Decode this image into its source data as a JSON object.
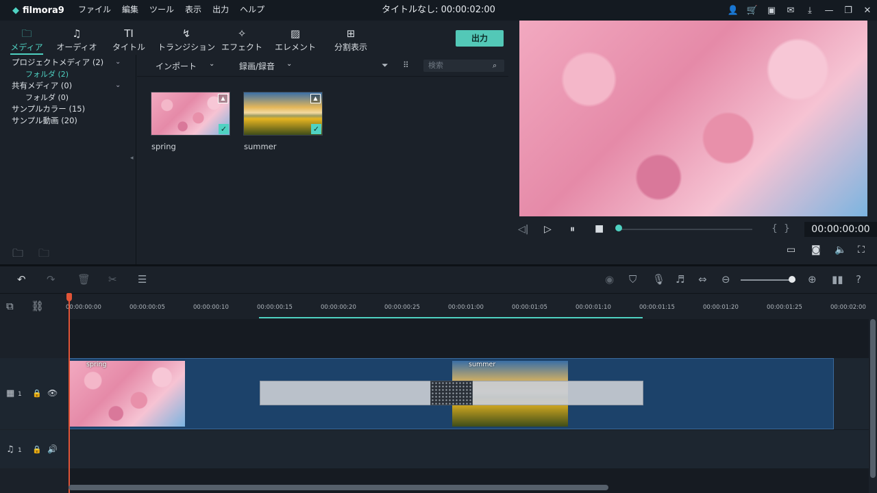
{
  "app": {
    "name": "filmora9",
    "doc_title": "タイトルなし: 00:00:02:00"
  },
  "menu": [
    "ファイル",
    "編集",
    "ツール",
    "表示",
    "出力",
    "ヘルプ"
  ],
  "tabs": [
    {
      "label": "メディア",
      "icon": "folder-icon"
    },
    {
      "label": "オーディオ",
      "icon": "music-note-icon"
    },
    {
      "label": "タイトル",
      "icon": "text-icon"
    },
    {
      "label": "トランジション",
      "icon": "transition-icon"
    },
    {
      "label": "エフェクト",
      "icon": "effect-icon"
    },
    {
      "label": "エレメント",
      "icon": "image-icon"
    },
    {
      "label": "分割表示",
      "icon": "split-screen-icon"
    }
  ],
  "export_label": "出力",
  "sidebar": [
    {
      "label": "プロジェクトメディア (2)"
    },
    {
      "label": "フォルダ (2)"
    },
    {
      "label": "共有メディア (0)"
    },
    {
      "label": "フォルダ (0)"
    },
    {
      "label": "サンプルカラー (15)"
    },
    {
      "label": "サンプル動画 (20)"
    }
  ],
  "media_bar": {
    "import": "インポート",
    "record": "録画/録音",
    "search_placeholder": "検索"
  },
  "media": [
    {
      "name": "spring"
    },
    {
      "name": "summer"
    }
  ],
  "preview": {
    "timecode": "00:00:00:00"
  },
  "ruler_ticks": [
    "00:00:00:00",
    "00:00:00:05",
    "00:00:00:10",
    "00:00:00:15",
    "00:00:00:20",
    "00:00:00:25",
    "00:00:01:00",
    "00:00:01:05",
    "00:00:01:10",
    "00:00:01:15",
    "00:00:01:20",
    "00:00:01:25",
    "00:00:02:00"
  ],
  "tracks": {
    "video_label": "1",
    "audio_label": "1"
  },
  "clips": [
    {
      "name": "spring"
    },
    {
      "name": "summer"
    }
  ]
}
